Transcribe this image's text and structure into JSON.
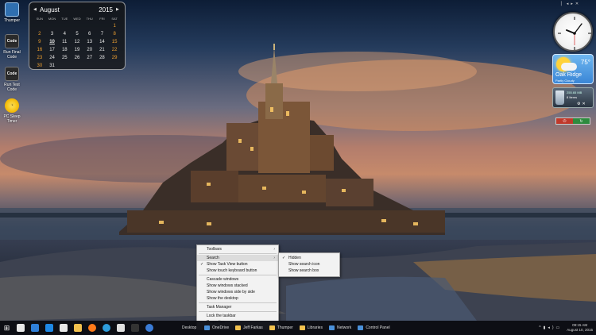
{
  "desktop_icons": [
    {
      "label": "Thumper",
      "icon": "folder-icon"
    },
    {
      "label": "Run Final Code",
      "glyph": "Code",
      "icon": "code-icon"
    },
    {
      "label": "Run Test Code",
      "glyph": "Code",
      "icon": "code-icon"
    },
    {
      "label": "PC Sleep Timer",
      "icon": "timer-icon"
    }
  ],
  "calendar": {
    "month": "August",
    "year": "2015",
    "weekdays": [
      "SUN",
      "MON",
      "TUE",
      "WED",
      "THU",
      "FRI",
      "SAT"
    ],
    "today": "10",
    "weeks": [
      [
        "",
        "",
        "",
        "",
        "",
        "",
        "1"
      ],
      [
        "2",
        "3",
        "4",
        "5",
        "6",
        "7",
        "8"
      ],
      [
        "9",
        "10",
        "11",
        "12",
        "13",
        "14",
        "15"
      ],
      [
        "16",
        "17",
        "18",
        "19",
        "20",
        "21",
        "22"
      ],
      [
        "23",
        "24",
        "25",
        "26",
        "27",
        "28",
        "29"
      ],
      [
        "30",
        "31",
        "",
        "",
        "",
        "",
        ""
      ]
    ]
  },
  "weather": {
    "temp": "75°",
    "city": "Oak Ridge",
    "condition": "Partly Cloudy"
  },
  "recycle_bin": {
    "size": "255.65 MB",
    "items": "8 Items"
  },
  "context_menu": {
    "items": [
      {
        "label": "Toolbars",
        "submenu": true
      },
      {
        "separator": true
      },
      {
        "label": "Search",
        "submenu": true,
        "highlighted": true
      },
      {
        "label": "Show Task View button",
        "checked": true
      },
      {
        "label": "Show touch keyboard button"
      },
      {
        "separator": true
      },
      {
        "label": "Cascade windows"
      },
      {
        "label": "Show windows stacked"
      },
      {
        "label": "Show windows side by side"
      },
      {
        "label": "Show the desktop"
      },
      {
        "separator": true
      },
      {
        "label": "Task Manager"
      },
      {
        "separator": true
      },
      {
        "label": "Lock the taskbar"
      },
      {
        "label": "Properties"
      }
    ],
    "search_submenu": [
      {
        "label": "Hidden",
        "checked": true
      },
      {
        "label": "Show search icon"
      },
      {
        "label": "Show search box"
      }
    ]
  },
  "taskbar": {
    "pinned": [
      {
        "icon": "task-view-icon",
        "color": "#e8e8e8"
      },
      {
        "icon": "file-explorer-icon",
        "color": "#2f7fd8"
      },
      {
        "icon": "edge-icon",
        "color": "#1e88e5"
      },
      {
        "icon": "store-icon",
        "color": "#e8e8e8"
      },
      {
        "icon": "folder-icon",
        "color": "#f2c14e"
      },
      {
        "icon": "firefox-icon",
        "color": "#ff7a1a"
      },
      {
        "icon": "media-player-icon",
        "color": "#2d9cdb"
      },
      {
        "icon": "media-play-icon",
        "color": "#e0e0e0"
      },
      {
        "icon": "command-prompt-icon",
        "color": "#333333"
      },
      {
        "icon": "windows-media-icon",
        "color": "#3a7bd5"
      }
    ],
    "desktop_label": "Desktop",
    "toolbar_links": [
      {
        "label": "OneDrive",
        "color": "#4a90d9"
      },
      {
        "label": "Jeff Farkas",
        "color": "#f2c14e"
      },
      {
        "label": "Thumper",
        "color": "#f2c14e"
      },
      {
        "label": "Libraries",
        "color": "#f2c14e"
      },
      {
        "label": "Network",
        "color": "#4a90d9"
      },
      {
        "label": "Control Panel",
        "color": "#4a90d9"
      }
    ],
    "time": "09:15 AM",
    "date": "August 10, 2015"
  }
}
